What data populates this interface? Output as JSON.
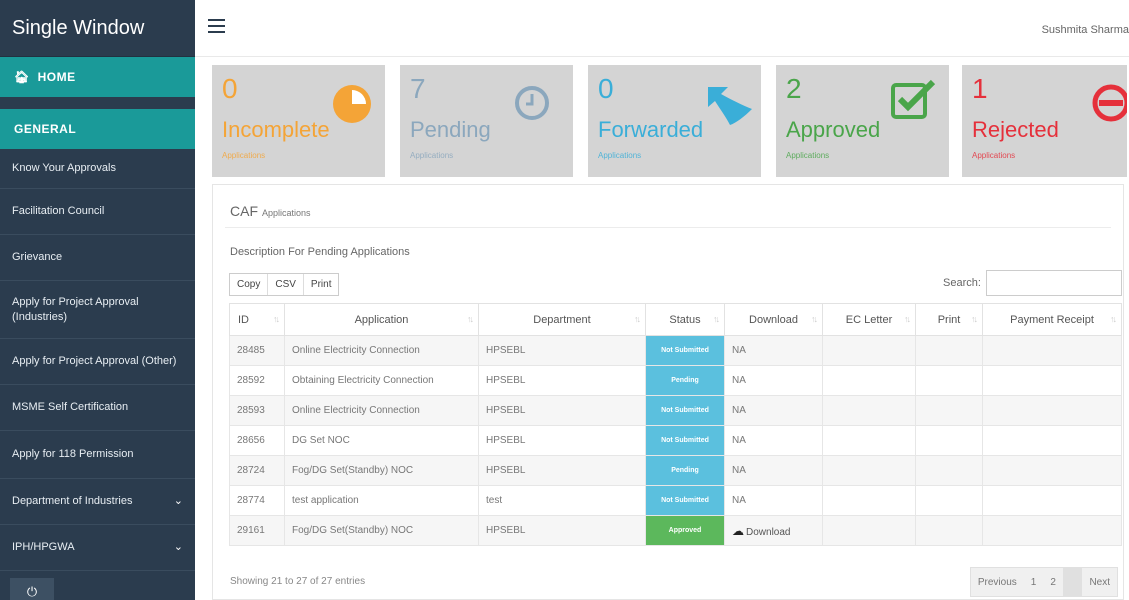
{
  "sidebar": {
    "brand": "Single Window",
    "home": "HOME",
    "general": "GENERAL",
    "items": [
      {
        "label": "Know Your Approvals"
      },
      {
        "label": "Facilitation Council"
      },
      {
        "label": "Grievance"
      },
      {
        "label": "Apply for Project Approval (Industries)"
      },
      {
        "label": "Apply for Project Approval (Other)"
      },
      {
        "label": "MSME Self Certification"
      },
      {
        "label": "Apply for 118 Permission"
      },
      {
        "label": "Department of Industries"
      },
      {
        "label": "IPH/HPGWA"
      }
    ]
  },
  "topbar": {
    "user": "Sushmita Sharma"
  },
  "cards": [
    {
      "count": "0",
      "label": "Incomplete",
      "sub": "Applications",
      "color": "#f4a437",
      "icon": "pie-chart-icon"
    },
    {
      "count": "7",
      "label": "Pending",
      "sub": "Applications",
      "color": "#8ba7bd",
      "icon": "clock-icon"
    },
    {
      "count": "0",
      "label": "Forwarded",
      "sub": "Applications",
      "color": "#3aaed8",
      "icon": "reply-arrow-icon"
    },
    {
      "count": "2",
      "label": "Approved",
      "sub": "Applications",
      "color": "#4aa54a",
      "icon": "check-square-icon"
    },
    {
      "count": "1",
      "label": "Rejected",
      "sub": "Applications",
      "color": "#e5303b",
      "icon": "ban-icon"
    }
  ],
  "panel": {
    "title": "CAF",
    "subtitle": "Applications",
    "description": "Description For Pending Applications",
    "buttons": {
      "copy": "Copy",
      "csv": "CSV",
      "print": "Print"
    },
    "search_label": "Search:",
    "search_value": ""
  },
  "table": {
    "columns": [
      "ID",
      "Application",
      "Department",
      "Status",
      "Download",
      "EC Letter",
      "Print",
      "Payment Receipt"
    ],
    "rows": [
      {
        "id": "28485",
        "application": "Online Electricity Connection",
        "department": "HPSEBL",
        "status": "Not Submitted",
        "download": "NA"
      },
      {
        "id": "28592",
        "application": "Obtaining Electricity Connection",
        "department": "HPSEBL",
        "status": "Pending",
        "download": "NA"
      },
      {
        "id": "28593",
        "application": "Online Electricity Connection",
        "department": "HPSEBL",
        "status": "Not Submitted",
        "download": "NA"
      },
      {
        "id": "28656",
        "application": "DG Set NOC",
        "department": "HPSEBL",
        "status": "Not Submitted",
        "download": "NA"
      },
      {
        "id": "28724",
        "application": "Fog/DG Set(Standby) NOC",
        "department": "HPSEBL",
        "status": "Pending",
        "download": "NA"
      },
      {
        "id": "28774",
        "application": "test application",
        "department": "test",
        "status": "Not Submitted",
        "download": "NA"
      },
      {
        "id": "29161",
        "application": "Fog/DG Set(Standby) NOC",
        "department": "HPSEBL",
        "status": "Approved",
        "download": "Download"
      }
    ],
    "status_colors": {
      "Not Submitted": "#5bc0de",
      "Pending": "#5bc0de",
      "Approved": "#5cb85c"
    }
  },
  "footer": {
    "info": "Showing 21 to 27 of 27 entries",
    "pager": {
      "previous": "Previous",
      "page1": "1",
      "page2": "2",
      "page3": "3",
      "next": "Next"
    }
  }
}
